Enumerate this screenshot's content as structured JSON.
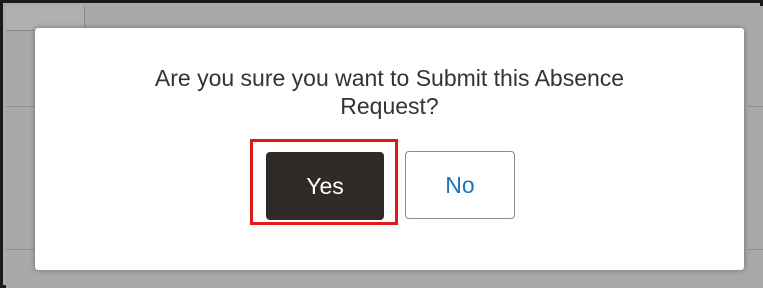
{
  "dialog": {
    "message_line1": "Are you sure you want to Submit this Absence",
    "message_line2": "Request?",
    "yes_label": "Yes",
    "no_label": "No"
  },
  "colors": {
    "yes_button_bg": "#312b28",
    "no_button_text": "#1f73b7",
    "highlight_border": "#e0191b",
    "overlay": "#a9a9a9"
  }
}
